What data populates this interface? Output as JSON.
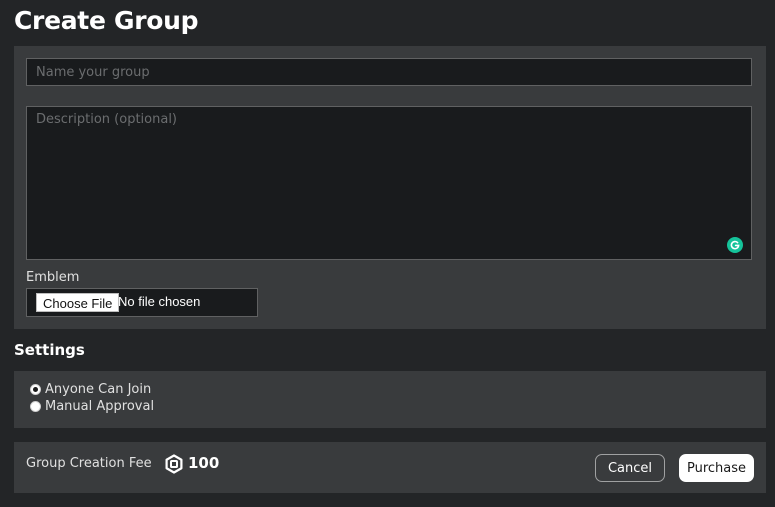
{
  "page": {
    "title": "Create Group"
  },
  "form": {
    "name_placeholder": "Name your group",
    "name_value": "",
    "description_placeholder": "Description (optional)",
    "description_value": "",
    "emblem_label": "Emblem",
    "choose_file_label": "Choose File",
    "file_status": "No file chosen"
  },
  "settings": {
    "heading": "Settings",
    "options": [
      {
        "label": "Anyone Can Join",
        "selected": true
      },
      {
        "label": "Manual Approval",
        "selected": false
      }
    ]
  },
  "fee": {
    "label": "Group Creation Fee",
    "currency_icon": "robux-icon",
    "amount": "100",
    "cancel_label": "Cancel",
    "purchase_label": "Purchase"
  },
  "colors": {
    "background": "#232527",
    "panel": "#393b3d",
    "input_background": "#191b1d",
    "grammarly": "#15c39a"
  }
}
